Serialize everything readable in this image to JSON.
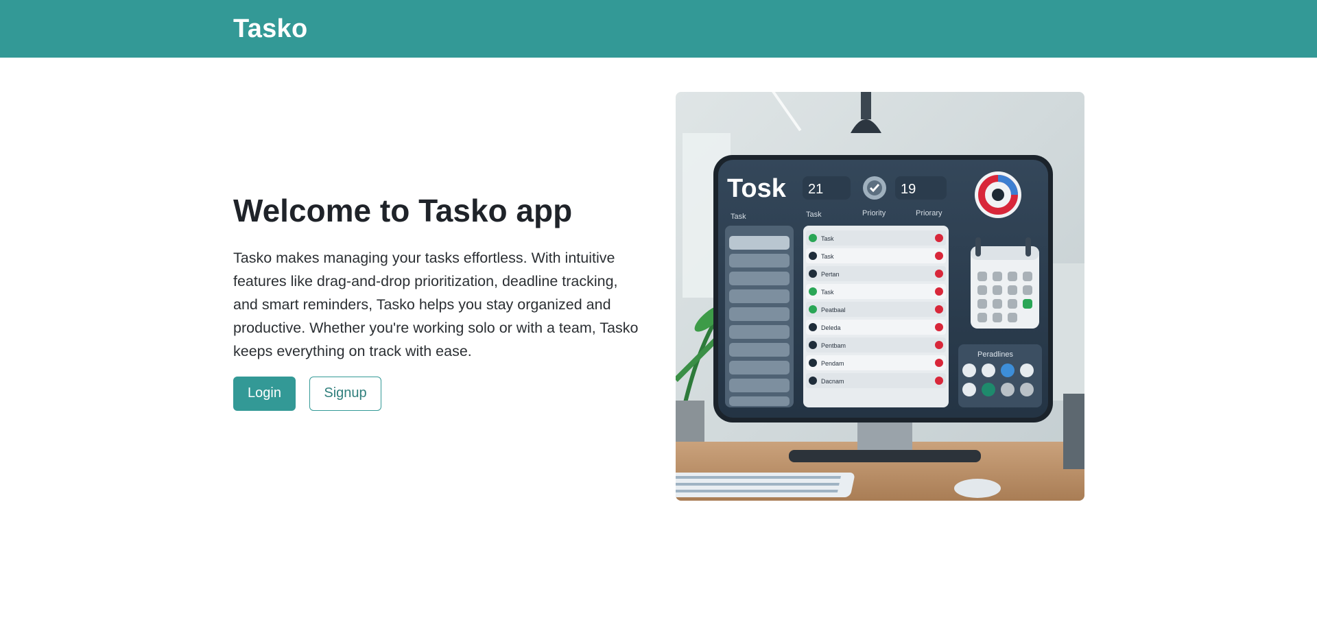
{
  "navbar": {
    "brand": "Tasko"
  },
  "hero": {
    "title": "Welcome to Tasko app",
    "description": "Tasko makes managing your tasks effortless. With intuitive features like drag-and-drop prioritization, deadline tracking, and smart reminders, Tasko helps you stay organized and productive. Whether you're working solo or with a team, Tasko keeps everything on track with ease.",
    "login_label": "Login",
    "signup_label": "Signup"
  },
  "illustration": {
    "screen_title": "Tosk",
    "counter_a": "21",
    "counter_b": "19",
    "col_task": "Task",
    "col_priority": "Priority",
    "col_priority2": "Priorary",
    "sidebar_title": "Task",
    "row_labels": [
      "Task",
      "Task",
      "Pertan",
      "Task",
      "Peatbaal",
      "Deleda",
      "Pentbam",
      "Pendam",
      "Dacnam"
    ],
    "deadlines_label": "Peradlines"
  },
  "colors": {
    "brand": "#339996",
    "text": "#212529"
  }
}
